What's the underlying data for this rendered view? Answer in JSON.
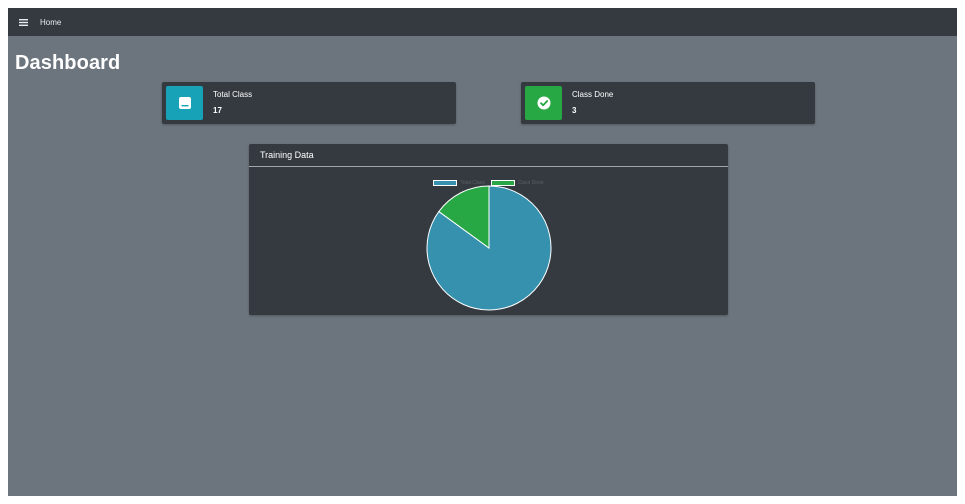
{
  "topbar": {
    "menu_icon": "hamburger-menu-icon",
    "home_label": "Home"
  },
  "page": {
    "title": "Dashboard"
  },
  "stats": [
    {
      "label": "Total Class",
      "value": "17",
      "icon": "book-icon",
      "color": "#17a2b8"
    },
    {
      "label": "Class Done",
      "value": "3",
      "icon": "check-circle-icon",
      "color": "#28a745"
    }
  ],
  "panel": {
    "title": "Training Data"
  },
  "chart_data": {
    "type": "pie",
    "categories": [
      "Total Class",
      "Class Done"
    ],
    "values": [
      17,
      3
    ],
    "colors": [
      "#3591ad",
      "#28a745"
    ],
    "legend_position": "top"
  }
}
